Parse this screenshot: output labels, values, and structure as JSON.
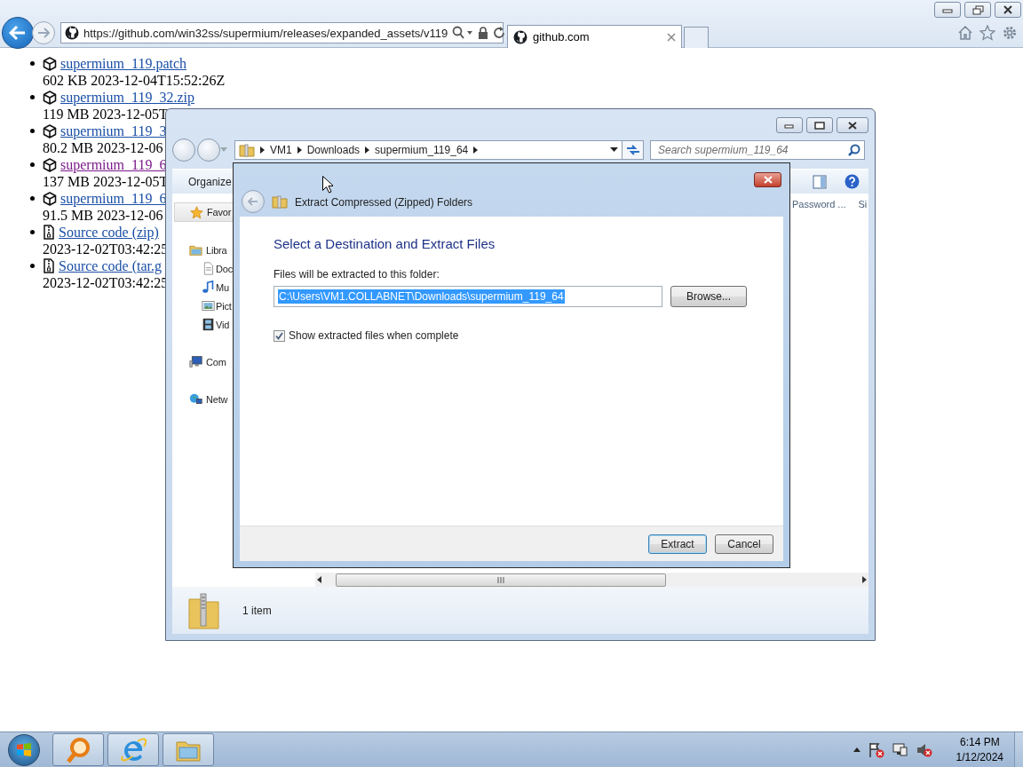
{
  "browser": {
    "address": "https://github.com/win32ss/supermium/releases/expanded_assets/v119",
    "tabs": [
      {
        "label": "github.com",
        "selected": true
      }
    ]
  },
  "page": {
    "assets": [
      {
        "kind": "package",
        "name": "supermium_119.patch",
        "details": "602 KB 2023-12-04T15:52:26Z",
        "visited": false
      },
      {
        "kind": "package",
        "name": "supermium_119_32.zip",
        "details": "119 MB 2023-12-05T",
        "visited": false
      },
      {
        "kind": "package",
        "name": "supermium_119_3",
        "details": "80.2 MB 2023-12-06",
        "visited": false
      },
      {
        "kind": "package",
        "name": "supermium_119_6",
        "details": "137 MB 2023-12-05T",
        "visited": true
      },
      {
        "kind": "package",
        "name": "supermium_119_6",
        "details": "91.5 MB 2023-12-06",
        "visited": false
      },
      {
        "kind": "archive",
        "name": "Source code (zip)",
        "details": "2023-12-02T03:42:25",
        "visited": false
      },
      {
        "kind": "archive",
        "name": "Source code (tar.g",
        "details": "2023-12-02T03:42:25",
        "visited": false
      }
    ]
  },
  "explorer": {
    "breadcrumb": [
      "VM1",
      "Downloads",
      "supermium_119_64"
    ],
    "search": {
      "placeholder": "Search supermium_119_64"
    },
    "toolbar": [
      "Organize"
    ],
    "nav": [
      {
        "kind": "favorites",
        "label": "Favor",
        "selected": true
      },
      {
        "kind": "libraries",
        "label": "Libra",
        "selected": false,
        "children": [
          {
            "kind": "documents",
            "label": "Doc",
            "selected": false
          },
          {
            "kind": "music",
            "label": "Mu",
            "selected": false
          },
          {
            "kind": "pictures",
            "label": "Pict",
            "selected": false
          },
          {
            "kind": "videos",
            "label": "Vid",
            "selected": false
          }
        ]
      },
      {
        "kind": "computer",
        "label": "Com",
        "selected": false
      },
      {
        "kind": "network",
        "label": "Netw",
        "selected": false
      }
    ],
    "columns": [
      "Password ...",
      "Si"
    ],
    "status": "1 item"
  },
  "dialog": {
    "title": "Extract Compressed (Zipped) Folders",
    "heading": "Select a Destination and Extract Files",
    "field_label": "Files will be extracted to this folder:",
    "path": {
      "value": "C:\\Users\\VM1.COLLABNET\\Downloads\\supermium_119_64",
      "selected": true
    },
    "browse": "Browse...",
    "show_files": {
      "label": "Show extracted files when complete",
      "checked": true
    },
    "buttons": [
      "Extract",
      "Cancel"
    ]
  },
  "taskbar": {
    "time": "6:14 PM",
    "date": "1/12/2024"
  }
}
